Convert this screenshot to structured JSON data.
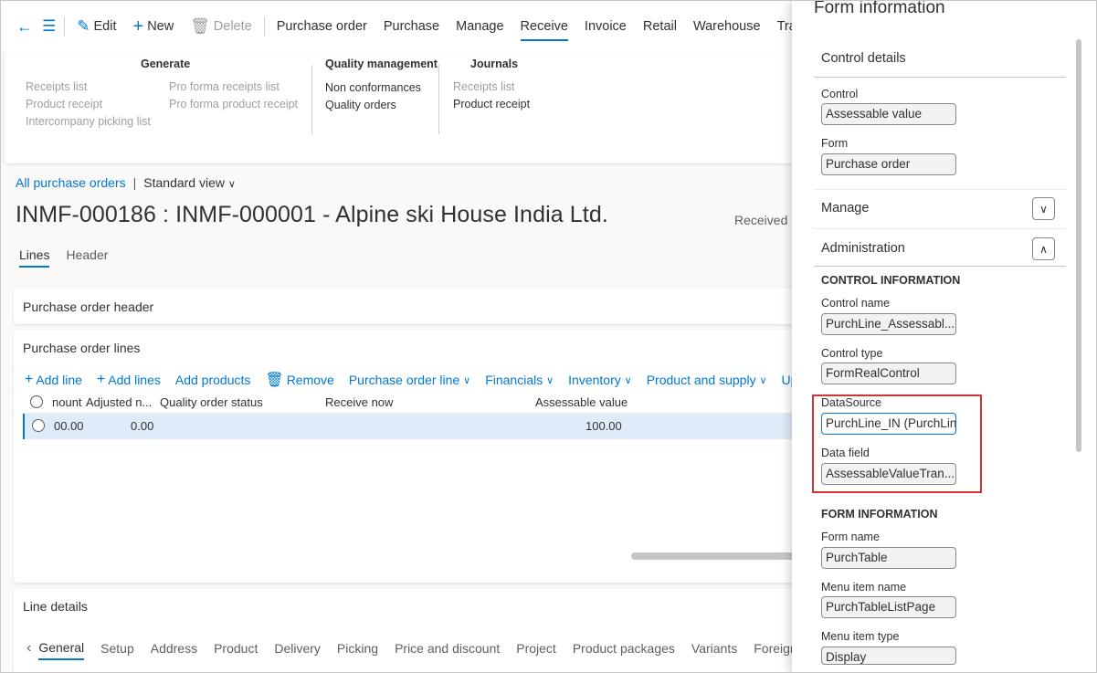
{
  "actionbar": {
    "edit": "Edit",
    "new": "New",
    "delete": "Delete",
    "tabs": [
      "Purchase order",
      "Purchase",
      "Manage",
      "Receive",
      "Invoice",
      "Retail",
      "Warehouse",
      "Transportation"
    ]
  },
  "ribbon": {
    "generate": {
      "title": "Generate",
      "col1": [
        "Receipts list",
        "Product receipt",
        "Intercompany picking list"
      ],
      "col2": [
        "Pro forma receipts list",
        "Pro forma product receipt"
      ]
    },
    "quality": {
      "title": "Quality management",
      "items": [
        "Non conformances",
        "Quality orders"
      ]
    },
    "journals": {
      "title": "Journals",
      "items": [
        "Receipts list",
        "Product receipt"
      ]
    }
  },
  "breadcrumb": {
    "link": "All purchase orders",
    "separator": "|",
    "view": "Standard view"
  },
  "page": {
    "title": "INMF-000186 : INMF-000001 - Alpine ski House India Ltd.",
    "status": "Received",
    "tabs": [
      "Lines",
      "Header"
    ]
  },
  "po_header": {
    "title": "Purchase order header"
  },
  "po_lines": {
    "title": "Purchase order lines",
    "toolbar": {
      "add_line": "Add line",
      "add_lines": "Add lines",
      "add_products": "Add products",
      "remove": "Remove",
      "po_line": "Purchase order line",
      "financials": "Financials",
      "inventory": "Inventory",
      "product_supply": "Product and supply",
      "update": "Upd"
    },
    "columns": {
      "amount": "nount",
      "adjusted": "Adjusted n...",
      "quality": "Quality order status",
      "receive_now": "Receive now",
      "assessable": "Assessable value"
    },
    "row": {
      "amount": "00.00",
      "adjusted": "0.00",
      "assessable": "100.00"
    }
  },
  "line_details": {
    "title": "Line details",
    "tabs": [
      "General",
      "Setup",
      "Address",
      "Product",
      "Delivery",
      "Picking",
      "Price and discount",
      "Project",
      "Product packages",
      "Variants",
      "Foreign tra"
    ]
  },
  "side_panel": {
    "title": "Form information",
    "control_details": "Control details",
    "control_label": "Control",
    "control_value": "Assessable value",
    "form_label": "Form",
    "form_value": "Purchase order",
    "manage": "Manage",
    "administration": "Administration",
    "control_info_caps": "CONTROL INFORMATION",
    "control_name_label": "Control name",
    "control_name_value": "PurchLine_Assessabl...",
    "control_type_label": "Control type",
    "control_type_value": "FormRealControl",
    "datasource_label": "DataSource",
    "datasource_value": "PurchLine_IN (PurchLin",
    "datafield_label": "Data field",
    "datafield_value": "AssessableValueTran...",
    "form_info_caps": "FORM INFORMATION",
    "form_name_label": "Form name",
    "form_name_value": "PurchTable",
    "menu_item_name_label": "Menu item name",
    "menu_item_name_value": "PurchTableListPage",
    "menu_item_type_label": "Menu item type",
    "menu_item_type_value": "Display"
  },
  "colors": {
    "accent": "#0078d4",
    "highlight": "#d13438",
    "selected_row": "#deecf9"
  }
}
